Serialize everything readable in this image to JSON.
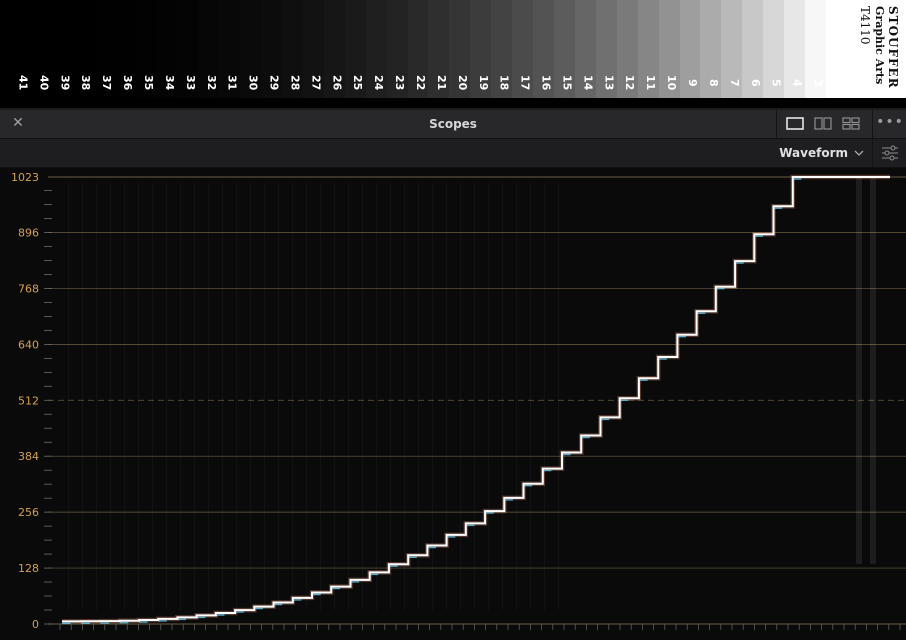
{
  "step_wedge": {
    "numbers": [
      "41",
      "40",
      "39",
      "38",
      "37",
      "36",
      "35",
      "34",
      "33",
      "32",
      "31",
      "30",
      "29",
      "28",
      "27",
      "26",
      "25",
      "24",
      "23",
      "22",
      "21",
      "20",
      "19",
      "18",
      "17",
      "16",
      "15",
      "14",
      "13",
      "12",
      "11",
      "10",
      "9",
      "8",
      "7",
      "6",
      "5",
      "4",
      "3"
    ],
    "brand_line1": "STOUFFER",
    "brand_line2": "Graphic Arts",
    "brand_line3": "T4110"
  },
  "panel": {
    "title": "Scopes",
    "close_icon": "close-icon",
    "layout_icons": [
      "single-view-icon",
      "dual-view-icon",
      "quad-view-icon"
    ],
    "more_icon": "more-dots-icon"
  },
  "toolbar": {
    "scope_type": "Waveform",
    "chevron_icon": "chevron-down-icon",
    "settings_icon": "sliders-icon"
  },
  "waveform": {
    "y_tick_labels": [
      "1023",
      "896",
      "768",
      "640",
      "512",
      "384",
      "256",
      "128",
      "0"
    ],
    "y_range": [
      0,
      1023
    ],
    "midline": 512,
    "colors": {
      "grid": "#8a7a55",
      "label": "#d2a052",
      "trace": "#ffffff",
      "background": "#0a0a0b"
    }
  }
}
